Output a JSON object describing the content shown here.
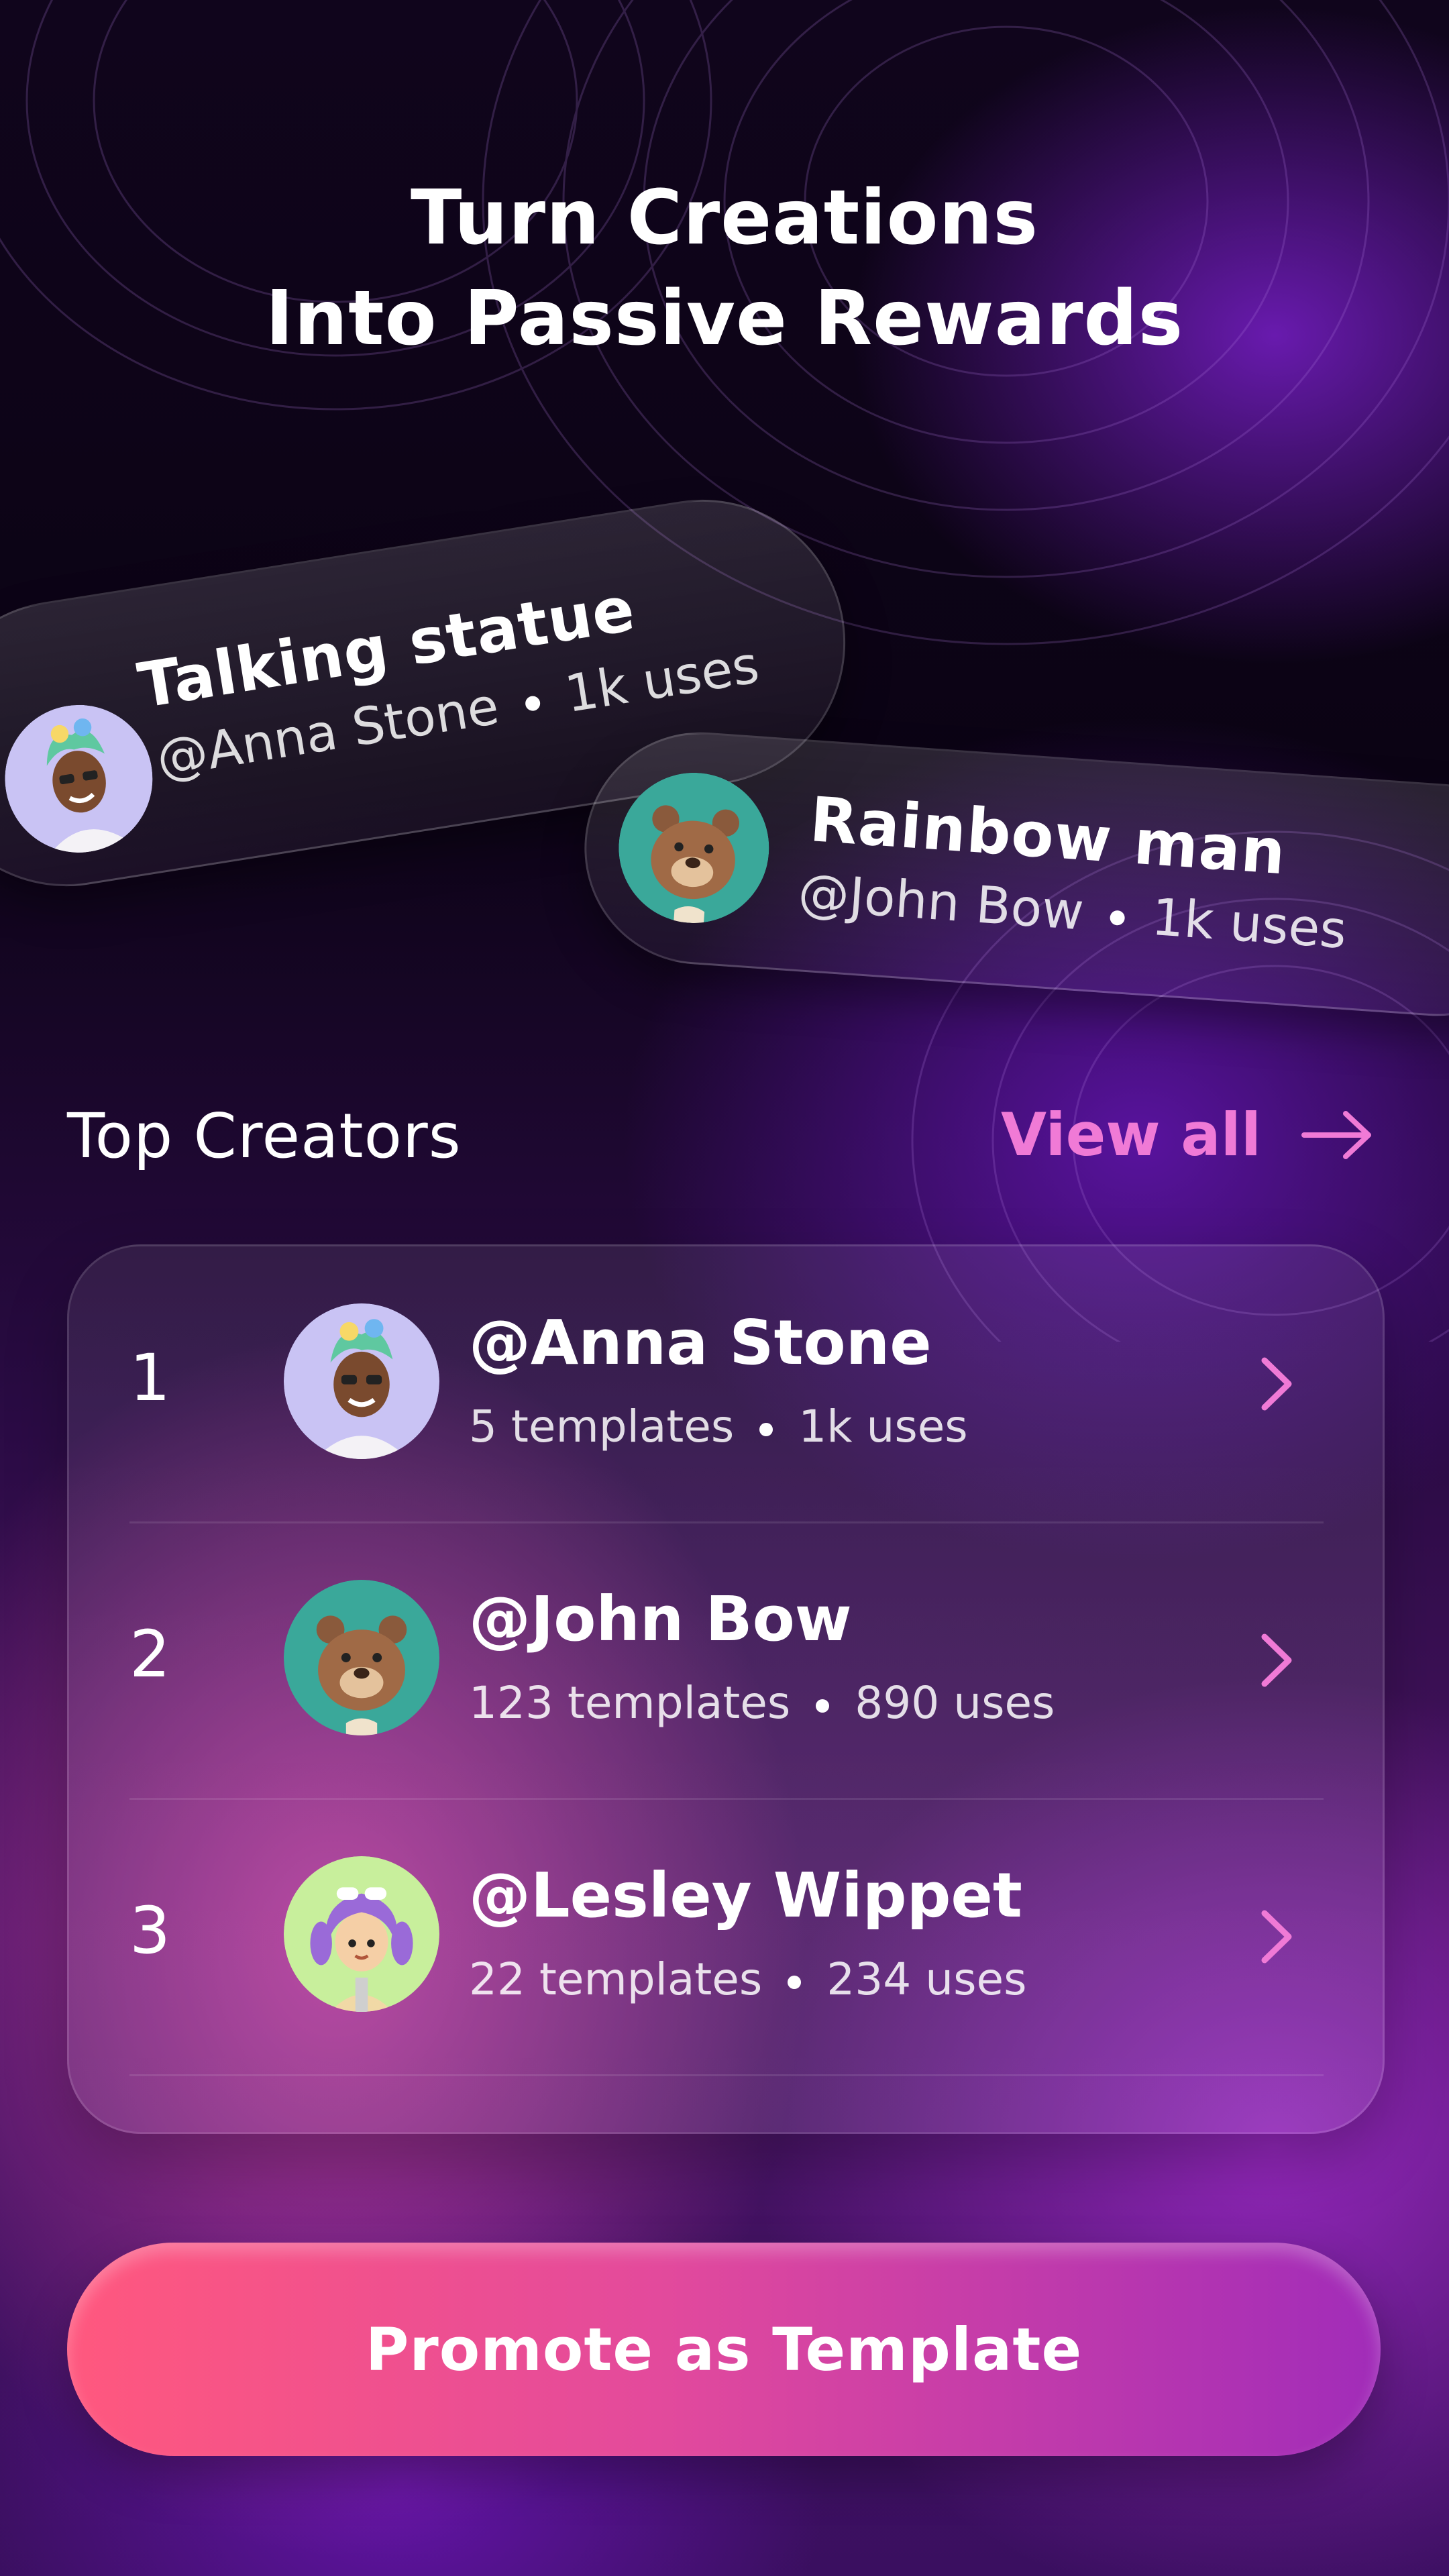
{
  "hero": {
    "line1": "Turn Creations",
    "line2": "Into Passive Rewards"
  },
  "featured": [
    {
      "title": "Talking statue",
      "author": "@Anna Stone",
      "uses": "1k uses",
      "avatar_icon": "avatar-green-hair-character"
    },
    {
      "title": "Rainbow man",
      "author": "@John Bow",
      "uses": "1k uses",
      "avatar_icon": "avatar-bear-character"
    }
  ],
  "top_creators": {
    "title": "Top Creators",
    "view_all_label": "View all",
    "items": [
      {
        "rank": "1",
        "handle": "@Anna Stone",
        "templates": "5 templates",
        "uses": "1k uses",
        "avatar_icon": "avatar-green-hair-character"
      },
      {
        "rank": "2",
        "handle": "@John Bow",
        "templates": "123 templates",
        "uses": "890 uses",
        "avatar_icon": "avatar-bear-character"
      },
      {
        "rank": "3",
        "handle": "@Lesley Wippet",
        "templates": "22 templates",
        "uses": "234 uses",
        "avatar_icon": "avatar-purple-hair-character"
      }
    ]
  },
  "cta": {
    "label": "Promote as Template"
  },
  "colors": {
    "accent_pink": "#f07ad6",
    "cta_start": "#ff587e",
    "cta_end": "#a12cb9"
  }
}
